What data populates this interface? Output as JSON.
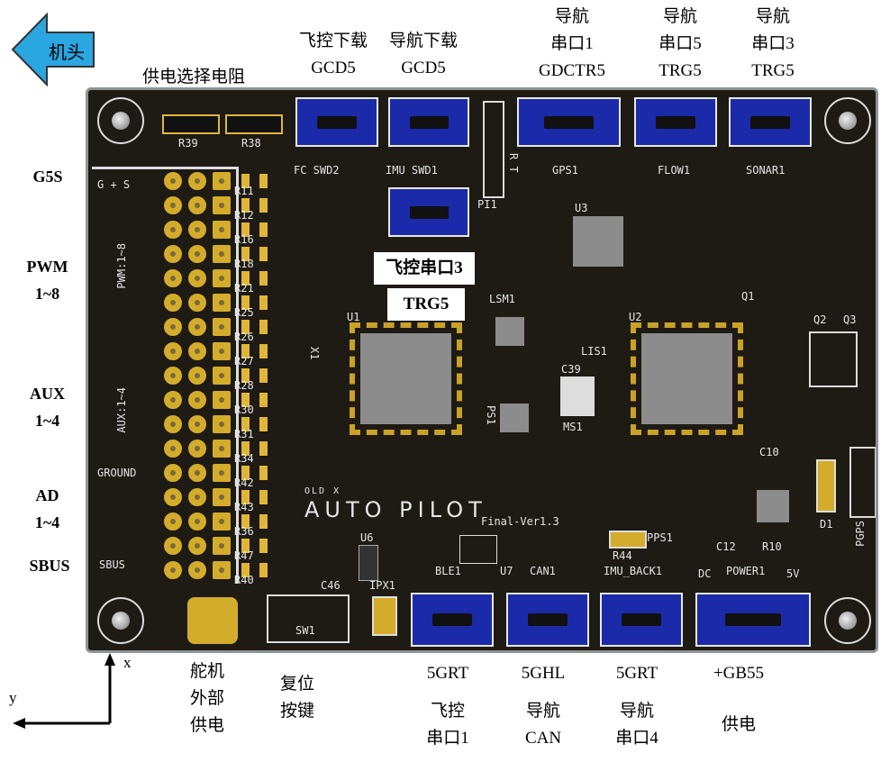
{
  "direction": {
    "label": "机头",
    "color": "#2aa6e0"
  },
  "top_labels": {
    "power_resistor": "供电选择电阻",
    "fc_download": [
      "飞控下载",
      "GCD5"
    ],
    "nav_download": [
      "导航下载",
      "GCD5"
    ],
    "nav_uart1": [
      "导航",
      "串口1",
      "GDCTR5"
    ],
    "nav_uart5": [
      "导航",
      "串口5",
      "TRG5"
    ],
    "nav_uart3": [
      "导航",
      "串口3",
      "TRG5"
    ]
  },
  "left_labels": {
    "g5s": "G5S",
    "pwm": [
      "PWM",
      "1~8"
    ],
    "aux": [
      "AUX",
      "1~4"
    ],
    "ad": [
      "AD",
      "1~4"
    ],
    "sbus": "SBUS"
  },
  "callout": {
    "line1": "飞控串口3",
    "line2": "TRG5"
  },
  "axes": {
    "x": "x",
    "y": "y"
  },
  "bottom_labels": {
    "servo_power": [
      "舵机",
      "外部",
      "供电"
    ],
    "reset": [
      "复位",
      "按键"
    ],
    "fc_uart1": [
      "5GRT",
      "飞控",
      "串口1"
    ],
    "nav_can": [
      "5GHL",
      "导航",
      "CAN"
    ],
    "nav_uart4": [
      "5GRT",
      "导航",
      "串口4"
    ],
    "power": [
      "+GB55",
      "供电"
    ]
  },
  "pcb": {
    "colors": {
      "board": "#1e1a14",
      "connector": "#1b2aa8",
      "pad": "#d4ac2b",
      "ic": "#8c8c8c"
    },
    "silk": {
      "r39": "R39",
      "r38": "R38",
      "fc_swd2": "FC SWD2",
      "imu_swd1": "IMU SWD1",
      "gps1": "GPS1",
      "flow1": "FLOW1",
      "sonar1": "SONAR1",
      "pi1": "PI1",
      "u3": "U3",
      "u1": "U1",
      "u2": "U2",
      "lsm1": "LSM1",
      "ms1": "MS1",
      "c39": "C39",
      "lis1": "LIS1",
      "gs": "G + S",
      "pwm": "PWM:1~8",
      "aux": "AUX:1~4",
      "ground": "GROUND",
      "sbus": "SBUS",
      "old_x": "OLD X",
      "autopilot": "AUTO PILOT",
      "version": "Final-Ver1.3",
      "ble1": "BLE1",
      "u7": "U7",
      "can1": "CAN1",
      "imu_back1": "IMU_BACK1",
      "dc": "DC",
      "power1": "POWER1",
      "v5": "5V",
      "sw1": "SW1",
      "ipx1": "IPX1",
      "c46": "C46",
      "u6": "U6",
      "pps1": "PPS1",
      "pgps": "PGPS",
      "d1": "D1",
      "q1": "Q1",
      "q2": "Q2",
      "q3": "Q3",
      "r44": "R44",
      "c12": "C12",
      "r10": "R10",
      "x1": "X1",
      "c10": "C10",
      "ps1": "PS1",
      "rt": "R T",
      "resistors": [
        "R11",
        "R12",
        "R16",
        "R18",
        "R21",
        "R25",
        "R26",
        "R27",
        "R28",
        "R30",
        "R31",
        "R34",
        "R42",
        "R43",
        "R36",
        "R47",
        "R40"
      ]
    }
  }
}
